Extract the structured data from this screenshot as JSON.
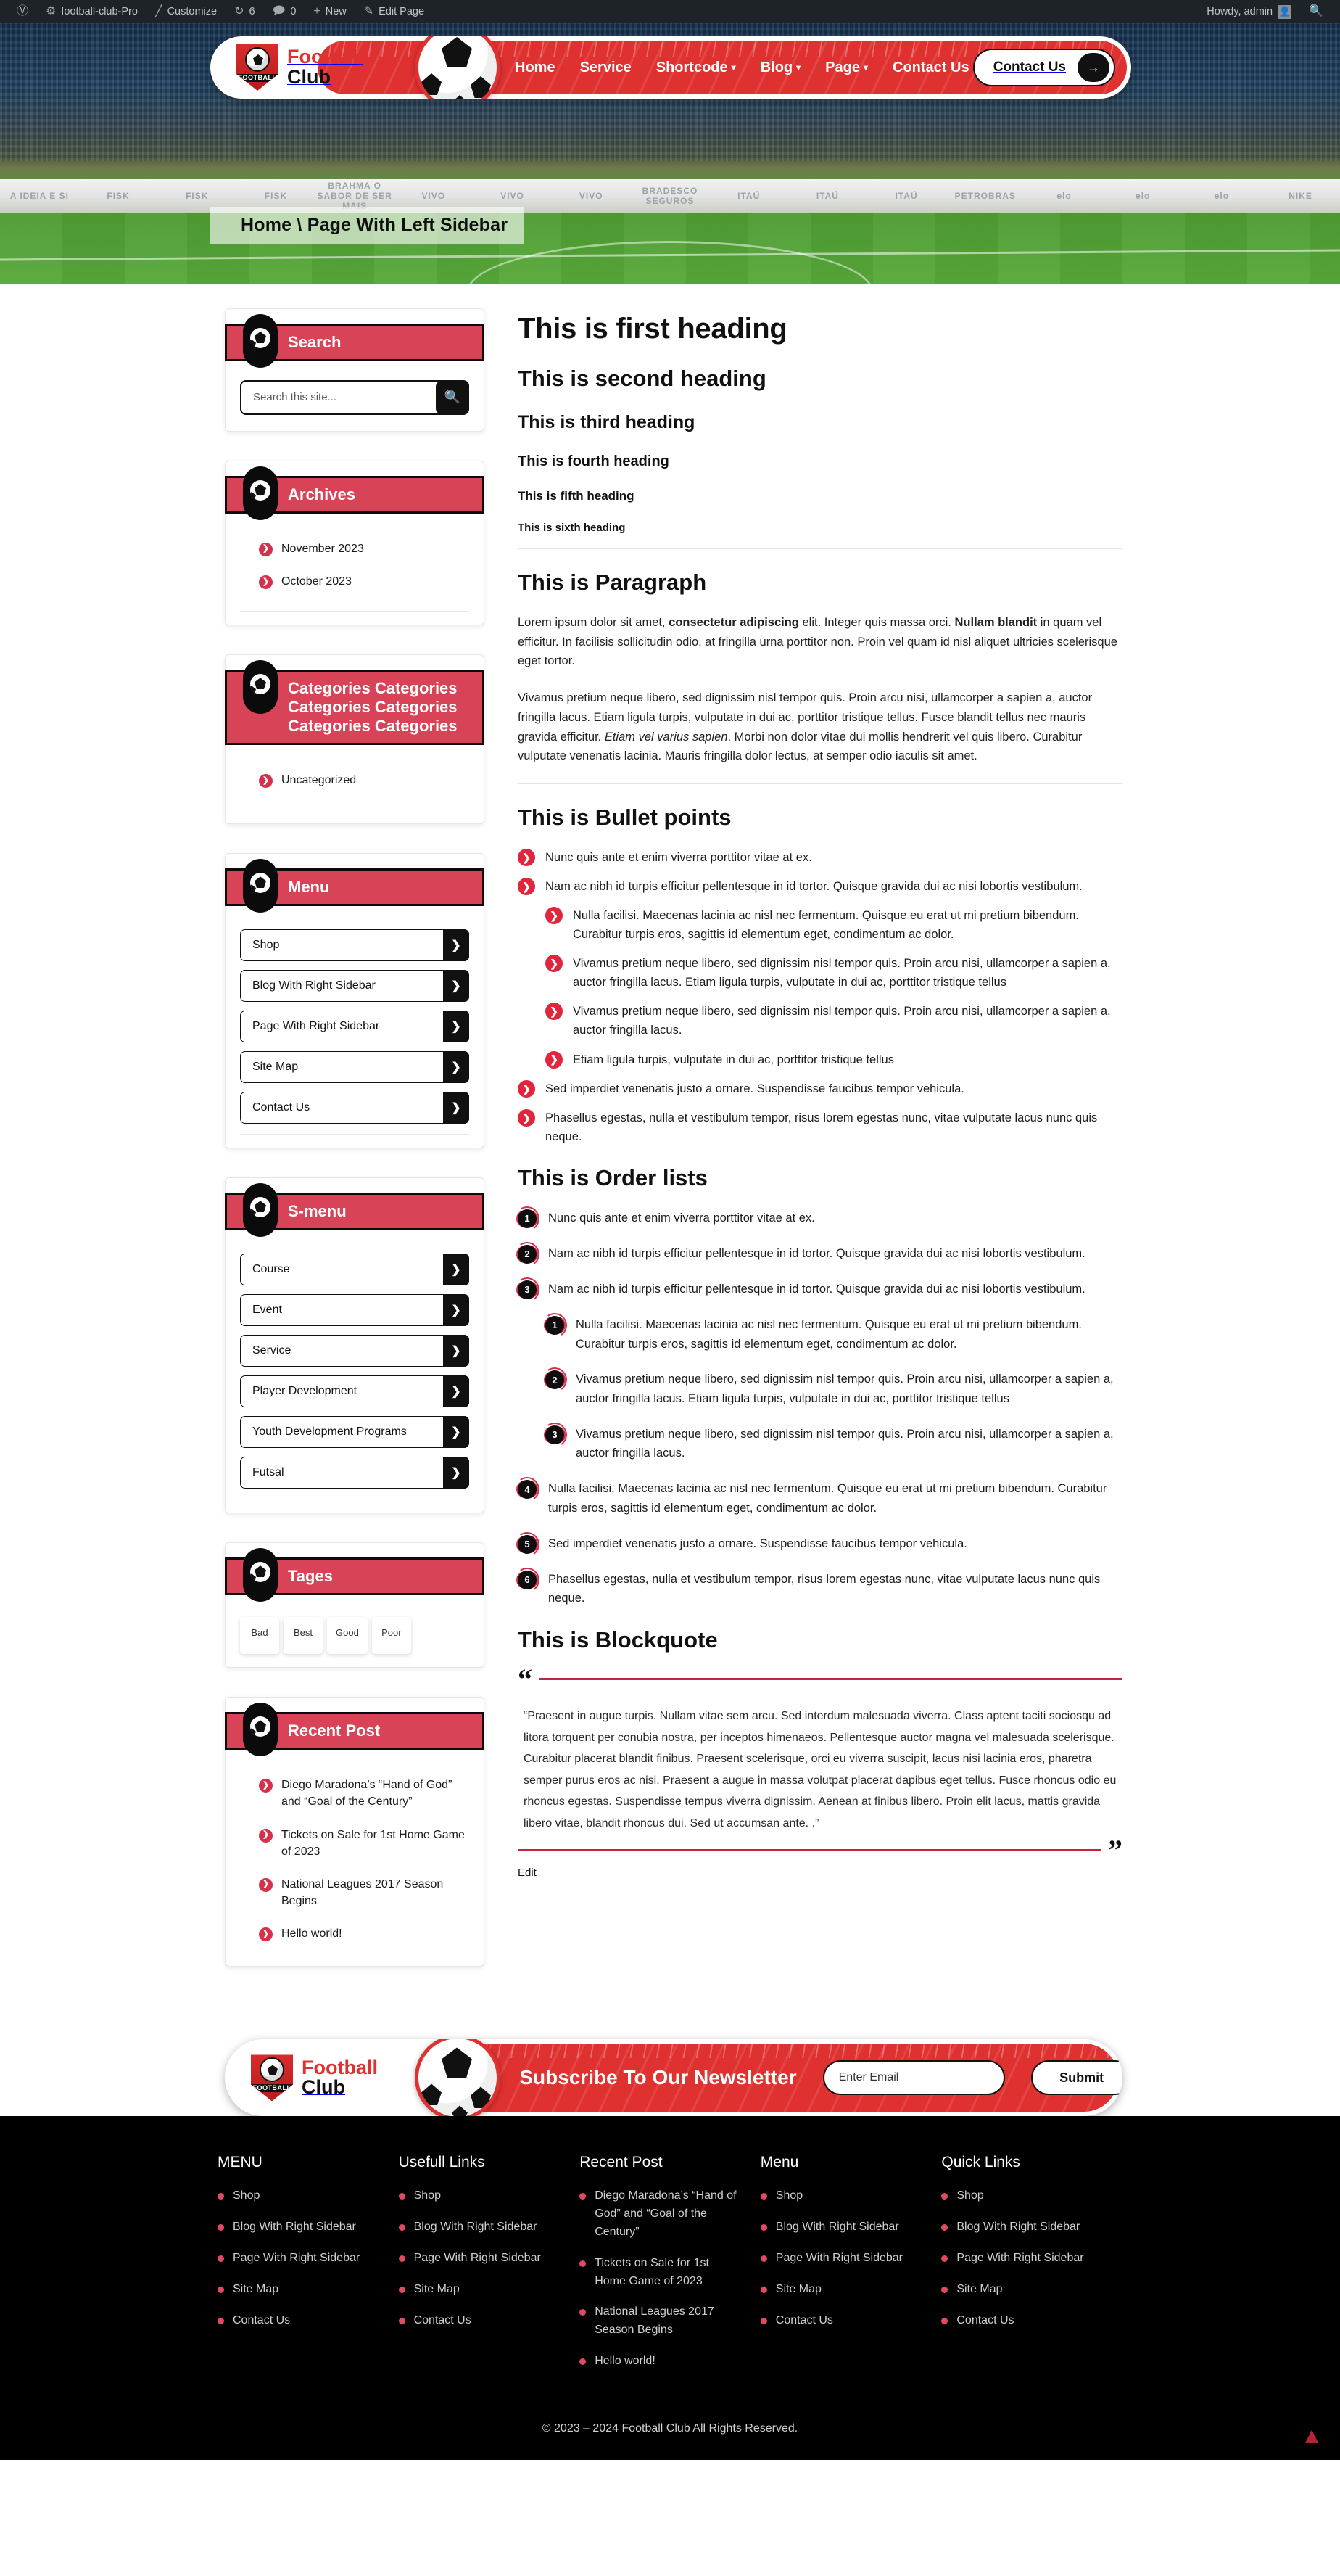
{
  "adminbar": {
    "wp_logo": "wordpress-icon",
    "site_name": "football-club-Pro",
    "customize": "Customize",
    "updates_count": "6",
    "comments_count": "0",
    "new": "New",
    "edit_page": "Edit Page",
    "howdy": "Howdy, admin",
    "search_icon": "search-icon"
  },
  "header": {
    "brand_line1": "Football",
    "brand_line2": "Club",
    "badge_text": "FOOTBALL",
    "nav": [
      {
        "label": "Home",
        "caret": false
      },
      {
        "label": "Service",
        "caret": false
      },
      {
        "label": "Shortcode",
        "caret": true
      },
      {
        "label": "Blog",
        "caret": true
      },
      {
        "label": "Page",
        "caret": true
      },
      {
        "label": "Contact Us",
        "caret": false
      }
    ],
    "cta_label": "Contact Us",
    "cta_arrow": "→"
  },
  "hero": {
    "breadcrumb": "Home \\ Page With Left Sidebar",
    "ads": [
      "A IDEIA E SI",
      "FISK",
      "FISK",
      "FISK",
      "BRAHMA  O SABOR DE SER MAIS",
      "VIVO",
      "VIVO",
      "VIVO",
      "BRADESCO SEGUROS",
      "ITAÚ",
      "ITAÚ",
      "ITAÚ",
      "PETROBRAS",
      "elo",
      "elo",
      "elo",
      "NIKE"
    ]
  },
  "sidebar": {
    "widgets": [
      {
        "id": "search",
        "title": "Search",
        "type": "search",
        "placeholder": "Search this site...",
        "value": "",
        "button_icon": "search-icon"
      },
      {
        "id": "archives",
        "title": "Archives",
        "type": "links",
        "items": [
          "November 2023",
          "October 2023"
        ]
      },
      {
        "id": "categories",
        "title": "Categories Categories Categories Categories Categories Categories",
        "type": "links",
        "items": [
          "Uncategorized"
        ]
      },
      {
        "id": "menu",
        "title": "Menu",
        "type": "menu",
        "items": [
          "Shop",
          "Blog With Right Sidebar",
          "Page With Right Sidebar",
          "Site Map",
          "Contact Us"
        ]
      },
      {
        "id": "s-menu",
        "title": "S-menu",
        "type": "menu",
        "items": [
          "Course",
          "Event",
          "Service",
          "Player Development",
          "Youth Development Programs",
          "Futsal"
        ]
      },
      {
        "id": "tages",
        "title": "Tages",
        "type": "tags",
        "items": [
          "Bad",
          "Best",
          "Good",
          "Poor"
        ]
      },
      {
        "id": "recent-post",
        "title": "Recent Post",
        "type": "links",
        "items": [
          "Diego Maradona’s “Hand of God” and “Goal of the Century”",
          "Tickets on Sale for 1st Home Game of 2023",
          "National Leagues 2017 Season Begins",
          "Hello world!"
        ]
      }
    ]
  },
  "main": {
    "headings": [
      "This is first heading",
      "This is second heading",
      "This is third heading",
      "This is fourth heading",
      "This is fifth heading",
      "This is sixth heading"
    ],
    "paragraph_title": "This is Paragraph",
    "paragraphs": [
      {
        "parts": [
          {
            "t": "Lorem ipsum dolor sit amet, ",
            "s": "n"
          },
          {
            "t": "consectetur adipiscing",
            "s": "b"
          },
          {
            "t": " elit. Integer quis massa orci. ",
            "s": "n"
          },
          {
            "t": "Nullam blandit",
            "s": "b"
          },
          {
            "t": " in quam vel efficitur. In facilisis sollicitudin odio, at fringilla urna porttitor non. Proin vel quam id nisl aliquet ultricies scelerisque eget tortor.",
            "s": "n"
          }
        ]
      },
      {
        "parts": [
          {
            "t": "Vivamus pretium neque libero, sed dignissim nisl tempor quis. Proin arcu nisi, ullamcorper a sapien a, auctor fringilla lacus. Etiam ligula turpis, vulputate in dui ac, porttitor tristique tellus. Fusce blandit tellus nec mauris gravida efficitur. ",
            "s": "n"
          },
          {
            "t": "Etiam vel varius sapien",
            "s": "i"
          },
          {
            "t": ". Morbi non dolor vitae dui mollis hendrerit vel quis libero. Curabitur vulputate venenatis lacinia. Mauris fringilla dolor lectus, at semper odio iaculis sit amet.",
            "s": "n"
          }
        ]
      }
    ],
    "bullet_title": "This is Bullet points",
    "bullets": [
      {
        "level": 1,
        "text": "Nunc quis ante et enim viverra porttitor vitae at ex."
      },
      {
        "level": 1,
        "text": "Nam ac nibh id turpis efficitur pellentesque in id tortor. Quisque gravida dui ac nisi lobortis vestibulum."
      },
      {
        "level": 2,
        "text": "Nulla facilisi. Maecenas lacinia ac nisl nec fermentum. Quisque eu erat ut mi pretium bibendum. Curabitur turpis eros, sagittis id elementum eget, condimentum ac dolor."
      },
      {
        "level": 2,
        "text": "Vivamus pretium neque libero, sed dignissim nisl tempor quis. Proin arcu nisi, ullamcorper a sapien a, auctor fringilla lacus. Etiam ligula turpis, vulputate in dui ac, porttitor tristique tellus"
      },
      {
        "level": 2,
        "text": "Vivamus pretium neque libero, sed dignissim nisl tempor quis. Proin arcu nisi, ullamcorper a sapien a, auctor fringilla lacus."
      },
      {
        "level": 2,
        "text": "Etiam ligula turpis, vulputate in dui ac, porttitor tristique tellus"
      },
      {
        "level": 1,
        "text": "Sed imperdiet venenatis justo a ornare. Suspendisse faucibus tempor vehicula."
      },
      {
        "level": 1,
        "text": "Phasellus egestas, nulla et vestibulum tempor, risus lorem egestas nunc, vitae vulputate lacus nunc quis neque."
      }
    ],
    "order_title": "This is Order lists",
    "ordered": [
      {
        "level": 1,
        "num": "1",
        "text": "Nunc quis ante et enim viverra porttitor vitae at ex."
      },
      {
        "level": 1,
        "num": "2",
        "text": "Nam ac nibh id turpis efficitur pellentesque in id tortor. Quisque gravida dui ac nisi lobortis vestibulum."
      },
      {
        "level": 1,
        "num": "3",
        "text": "Nam ac nibh id turpis efficitur pellentesque in id tortor. Quisque gravida dui ac nisi lobortis vestibulum."
      },
      {
        "level": 2,
        "num": "1",
        "text": "Nulla facilisi. Maecenas lacinia ac nisl nec fermentum. Quisque eu erat ut mi pretium bibendum. Curabitur turpis eros, sagittis id elementum eget, condimentum ac dolor."
      },
      {
        "level": 2,
        "num": "2",
        "text": "Vivamus pretium neque libero, sed dignissim nisl tempor quis. Proin arcu nisi, ullamcorper a sapien a, auctor fringilla lacus. Etiam ligula turpis, vulputate in dui ac, porttitor tristique tellus"
      },
      {
        "level": 2,
        "num": "3",
        "text": "Vivamus pretium neque libero, sed dignissim nisl tempor quis. Proin arcu nisi, ullamcorper a sapien a, auctor fringilla lacus."
      },
      {
        "level": 1,
        "num": "4",
        "text": "Nulla facilisi. Maecenas lacinia ac nisl nec fermentum. Quisque eu erat ut mi pretium bibendum. Curabitur turpis eros, sagittis id elementum eget, condimentum ac dolor."
      },
      {
        "level": 1,
        "num": "5",
        "text": "Sed imperdiet venenatis justo a ornare. Suspendisse faucibus tempor vehicula."
      },
      {
        "level": 1,
        "num": "6",
        "text": "Phasellus egestas, nulla et vestibulum tempor, risus lorem egestas nunc, vitae vulputate lacus nunc quis neque."
      }
    ],
    "blockquote_title": "This is Blockquote",
    "blockquote_text": "“Praesent in augue turpis. Nullam vitae sem arcu. Sed interdum malesuada viverra. Class aptent taciti sociosqu ad litora torquent per conubia nostra, per inceptos himenaeos. Pellentesque auctor magna vel malesuada scelerisque. Curabitur placerat blandit finibus. Praesent scelerisque, orci eu viverra suscipit, lacus nisi lacinia eros, pharetra semper purus eros ac nisi. Praesent a augue in massa volutpat placerat dapibus eget tellus. Fusce rhoncus odio eu rhoncus egestas. Suspendisse tempus viverra dignissim. Aenean at finibus libero. Proin elit lacus, mattis gravida libero vitae, blandit rhoncus dui. Sed ut accumsan ante. .”",
    "quote_open": "“",
    "quote_close": "”",
    "edit_label": "Edit"
  },
  "newsletter": {
    "brand_line1": "Football",
    "brand_line2": "Club",
    "badge_text": "FOOTBALL",
    "title": "Subscribe To Our Newsletter",
    "input_placeholder": "Enter Email",
    "input_value": "",
    "submit_label": "Submit"
  },
  "footer": {
    "columns": [
      {
        "title": "MENU",
        "items": [
          "Shop",
          "Blog With Right Sidebar",
          "Page With Right Sidebar",
          "Site Map",
          "Contact Us"
        ]
      },
      {
        "title": "Usefull Links",
        "items": [
          "Shop",
          "Blog With Right Sidebar",
          "Page With Right Sidebar",
          "Site Map",
          "Contact Us"
        ]
      },
      {
        "title": "Recent Post",
        "items": [
          "Diego Maradona’s “Hand of God” and “Goal of the Century”",
          "Tickets on Sale for 1st Home Game of 2023",
          "National Leagues 2017 Season Begins",
          "Hello world!"
        ]
      },
      {
        "title": "Menu",
        "items": [
          "Shop",
          "Blog With Right Sidebar",
          "Page With Right Sidebar",
          "Site Map",
          "Contact Us"
        ]
      },
      {
        "title": "Quick Links",
        "items": [
          "Shop",
          "Blog With Right Sidebar",
          "Page With Right Sidebar",
          "Site Map",
          "Contact Us"
        ]
      }
    ],
    "copyright": "© 2023 – 2024 Football Club All Rights Reserved.",
    "scroll_top_icon": "scroll-top-icon"
  },
  "colors": {
    "brand_red": "#e03131",
    "widget_red": "#d94357",
    "accent_pink": "#e34a5f",
    "black": "#0b0b0b"
  }
}
